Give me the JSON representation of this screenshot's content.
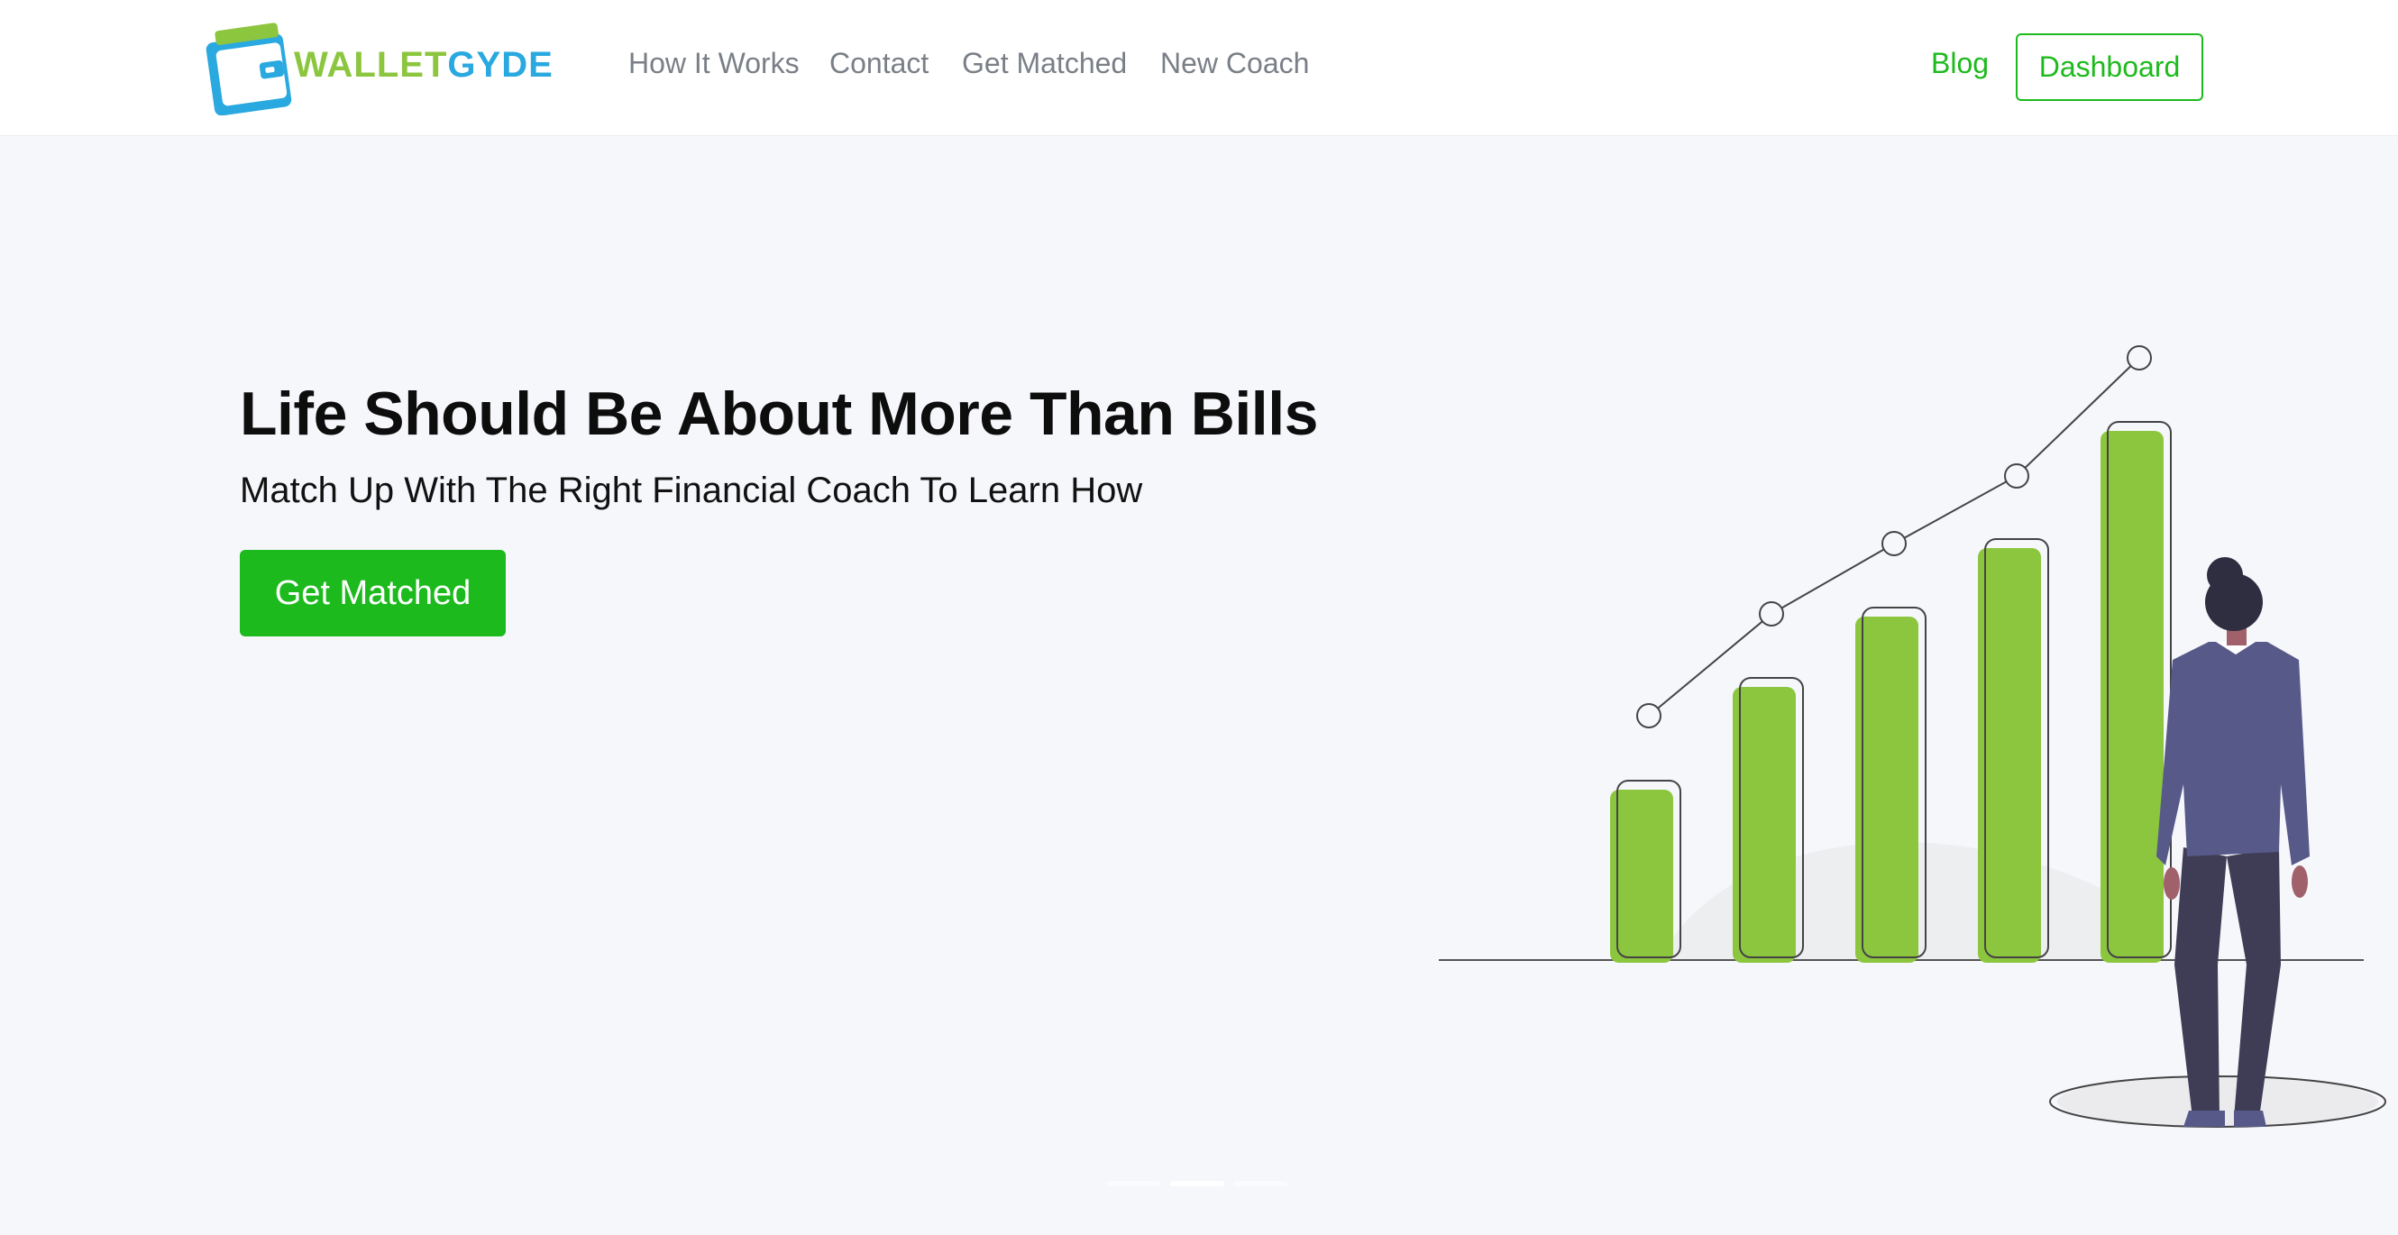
{
  "brand": {
    "logo_wallet": "WALLET",
    "logo_gyde": "GYDE",
    "colors": {
      "green": "#8cc63f",
      "blue": "#29a9df",
      "accent": "#1dba1d"
    }
  },
  "nav": {
    "links": [
      "How It Works",
      "Contact",
      "Get Matched",
      "New Coach"
    ],
    "blog": "Blog",
    "dashboard": "Dashboard"
  },
  "hero": {
    "title": "Life Should Be About More Than Bills",
    "subtitle": "Match Up With The Right Financial Coach To Learn How",
    "cta": "Get Matched"
  },
  "carousel": {
    "slide_count": 3,
    "active_index": 1
  },
  "illustration": {
    "name": "growth-chart-person",
    "bar_color": "#8cc63f",
    "suit_color": "#575a89"
  }
}
